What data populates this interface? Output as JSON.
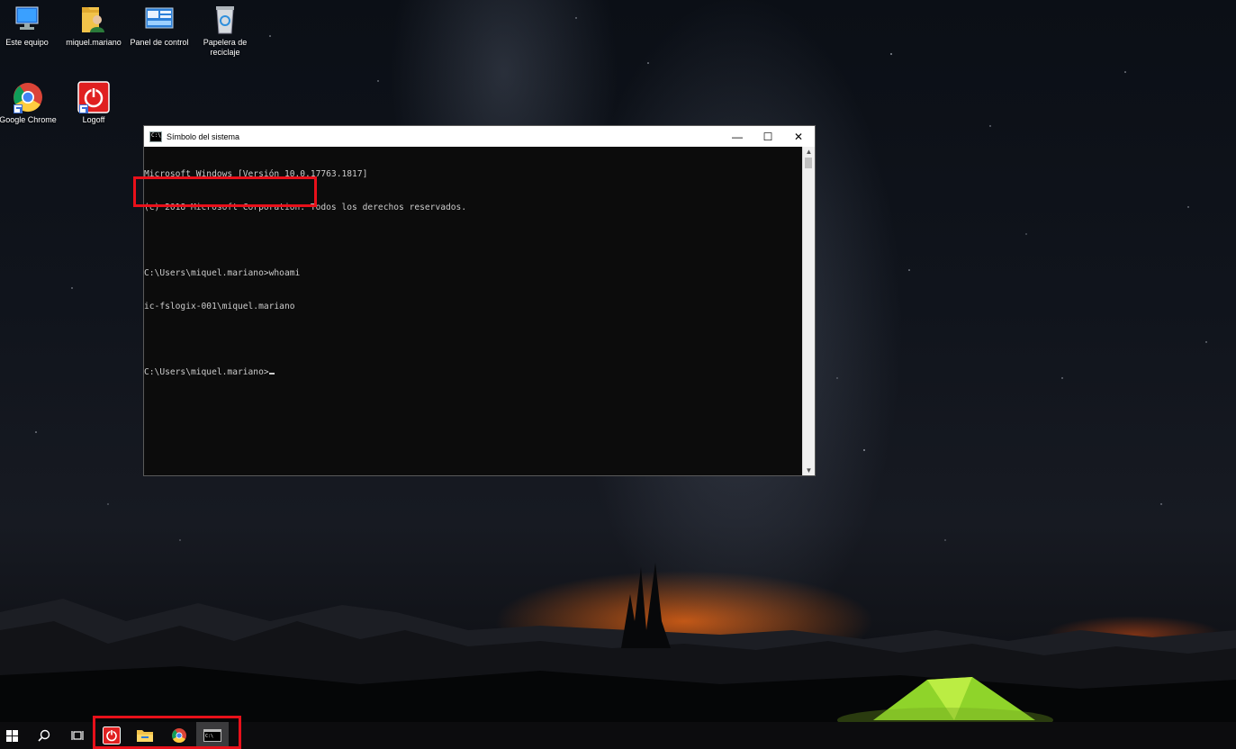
{
  "desktop": {
    "icons": [
      {
        "label": "Este equipo",
        "icon": "computer-icon"
      },
      {
        "label": "miquel.mariano",
        "icon": "user-folder-icon"
      },
      {
        "label": "Panel de control",
        "icon": "control-panel-icon"
      },
      {
        "label": "Papelera de reciclaje",
        "icon": "recycle-bin-icon"
      },
      {
        "label": "Google Chrome",
        "icon": "chrome-icon"
      },
      {
        "label": "Logoff",
        "icon": "power-icon"
      }
    ]
  },
  "window": {
    "title": "Símbolo del sistema",
    "app_icon_text": "C:\\",
    "buttons": {
      "minimize": "—",
      "maximize": "☐",
      "close": "✕"
    },
    "console_lines": [
      "Microsoft Windows [Versión 10.0.17763.1817]",
      "(c) 2018 Microsoft Corporation. Todos los derechos reservados.",
      "",
      "C:\\Users\\miquel.mariano>whoami",
      "ic-fslogix-001\\miquel.mariano",
      "",
      "C:\\Users\\miquel.mariano>"
    ]
  },
  "taskbar": {
    "items": [
      {
        "name": "start",
        "icon": "windows-logo-icon"
      },
      {
        "name": "search",
        "icon": "search-icon"
      },
      {
        "name": "task-view",
        "icon": "task-view-icon"
      },
      {
        "name": "logoff",
        "icon": "power-icon"
      },
      {
        "name": "file-explorer",
        "icon": "folder-icon"
      },
      {
        "name": "chrome",
        "icon": "chrome-icon"
      },
      {
        "name": "command-prompt",
        "icon": "cmd-icon"
      }
    ]
  },
  "colors": {
    "highlight": "#e8101a",
    "console_bg": "#0c0c0c",
    "console_text": "#cccccc",
    "taskbar_bg": "#0c0c0e"
  }
}
